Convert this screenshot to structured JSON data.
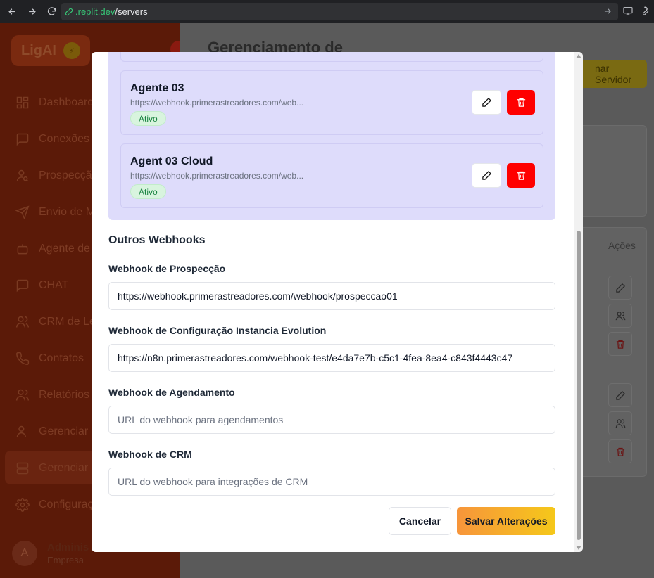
{
  "browser": {
    "url_subdomain": ".replit.dev",
    "url_path": "/servers"
  },
  "sidebar": {
    "logo": "LigAI",
    "items": [
      {
        "label": "Dashboard",
        "icon": "dashboard-icon"
      },
      {
        "label": "Conexões",
        "icon": "chat-bubble-icon"
      },
      {
        "label": "Prospecção",
        "icon": "user-search-icon"
      },
      {
        "label": "Envio de M",
        "icon": "send-icon"
      },
      {
        "label": "Agente de",
        "icon": "bot-icon"
      },
      {
        "label": "CHAT",
        "icon": "message-square-icon"
      },
      {
        "label": "CRM de Le",
        "icon": "users-icon"
      },
      {
        "label": "Contatos",
        "icon": "phone-icon"
      },
      {
        "label": "Relatórios",
        "icon": "users-icon"
      },
      {
        "label": "Gerenciar",
        "icon": "user-icon"
      },
      {
        "label": "Gerenciar",
        "icon": "server-icon"
      },
      {
        "label": "Configuraç",
        "icon": "gear-icon"
      }
    ],
    "user": {
      "initial": "A",
      "name": "Adminis",
      "role": "Empresa"
    }
  },
  "main": {
    "title": "Gerenciamento de",
    "add_server_label": "nar Servidor",
    "actions_header": "Ações"
  },
  "modal": {
    "agents": [
      {
        "name": "Agente 03",
        "url": "https://webhook.primerastreadores.com/web...",
        "status": "Ativo"
      },
      {
        "name": "Agent 03 Cloud",
        "url": "https://webhook.primerastreadores.com/web...",
        "status": "Ativo"
      }
    ],
    "section_title": "Outros Webhooks",
    "fields": [
      {
        "label": "Webhook de Prospecção",
        "value": "https://webhook.primerastreadores.com/webhook/prospeccao01",
        "placeholder": ""
      },
      {
        "label": "Webhook de Configuração Instancia Evolution",
        "value": "https://n8n.primerastreadores.com/webhook-test/e4da7e7b-c5c1-4fea-8ea4-c843f4443c47",
        "placeholder": ""
      },
      {
        "label": "Webhook de Agendamento",
        "value": "",
        "placeholder": "URL do webhook para agendamentos"
      },
      {
        "label": "Webhook de CRM",
        "value": "",
        "placeholder": "URL do webhook para integrações de CRM"
      }
    ],
    "cancel_label": "Cancelar",
    "save_label": "Salvar Alterações"
  }
}
